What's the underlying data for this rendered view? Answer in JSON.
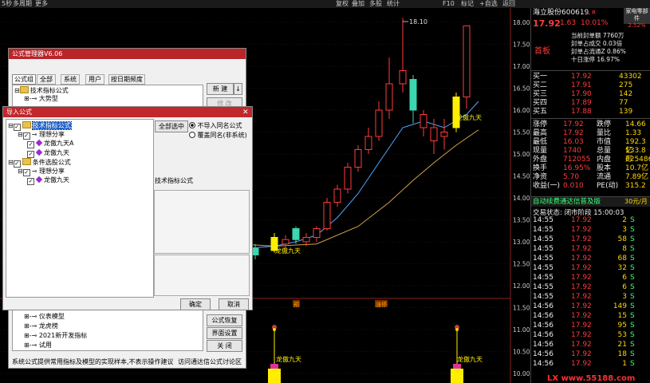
{
  "toolbar": {
    "left": [
      "5秒",
      "多周期",
      "更多"
    ],
    "right": [
      "复权",
      "叠加",
      "多股",
      "统计",
      "F10",
      "标记",
      "+自选",
      "返回"
    ]
  },
  "chart": {
    "peak_label": "18.10",
    "signal_label": "龙傲九天",
    "marker_yu": "预",
    "marker_zhang": "涨停",
    "price_ticks": [
      "18.00",
      "17.50",
      "17.00",
      "16.50",
      "16.00",
      "15.50",
      "15.00",
      "14.50",
      "14.00",
      "13.50",
      "13.00",
      "12.50",
      "12.00",
      "11.50",
      "11.00",
      "10.50",
      "10.00"
    ],
    "colors": {
      "up": "#ff3b3b",
      "down": "#3bd6b0",
      "signal": "#ffee00",
      "ma1": "#4fa8ff",
      "ma2": "#d4a24a"
    }
  },
  "quote": {
    "name": "海立股份",
    "code": "600619",
    "flag": "L R",
    "industry": "家电零部件",
    "industry_pct": "2.52%",
    "price": "17.92",
    "change": "1.63",
    "pct": "10.01%",
    "board": "首板",
    "seal_vol": "当前封单额 7760万",
    "seal_ratio_float": "封单占成交 0.03倍",
    "seal_ratio_z": "封单占流通Z 0.86%",
    "ten_day": "十日涨停 16.97%",
    "orders": [
      {
        "label": "买一",
        "price": "17.92",
        "vol": "43302"
      },
      {
        "label": "买二",
        "price": "17.91",
        "vol": "275"
      },
      {
        "label": "买三",
        "price": "17.90",
        "vol": "142"
      },
      {
        "label": "买四",
        "price": "17.89",
        "vol": "77"
      },
      {
        "label": "买五",
        "price": "17.88",
        "vol": "139"
      }
    ],
    "stats": [
      {
        "l1": "涨停",
        "v1": "17.92",
        "l2": "跌停",
        "v2": "14.66"
      },
      {
        "l1": "最高",
        "v1": "17.92",
        "l2": "量比",
        "v2": "1.33"
      },
      {
        "l1": "最低",
        "v1": "16.03",
        "l2": "市值",
        "v2": "192.3亿"
      },
      {
        "l1": "现量",
        "v1": "1740",
        "l2": "总量",
        "v2": "133.8万"
      },
      {
        "l1": "外盘",
        "v1": "712055",
        "l2": "内盘",
        "v2": "625486"
      },
      {
        "l1": "换手",
        "v1": "16.95%",
        "l2": "股本",
        "v2": "10.7亿"
      },
      {
        "l1": "净资",
        "v1": "5.70",
        "l2": "流通",
        "v2": "7.89亿"
      },
      {
        "l1": "收益(一)",
        "v1": "0.010",
        "l2": "PE(动)",
        "v2": "315.2"
      }
    ],
    "promo": "自动续费通达信普及版",
    "promo_price": "30元/月",
    "trade_status": "交易状态: 闭市阶段 15:00:03",
    "ticks": [
      {
        "t": "14:55",
        "p": "17.92",
        "v": "2",
        "s": "S"
      },
      {
        "t": "14:55",
        "p": "17.92",
        "v": "3",
        "s": "S"
      },
      {
        "t": "14:55",
        "p": "17.92",
        "v": "58",
        "s": "S"
      },
      {
        "t": "14:55",
        "p": "17.92",
        "v": "8",
        "s": "S"
      },
      {
        "t": "14:55",
        "p": "17.92",
        "v": "68",
        "s": "S"
      },
      {
        "t": "14:55",
        "p": "17.92",
        "v": "32",
        "s": "S"
      },
      {
        "t": "14:55",
        "p": "17.92",
        "v": "6",
        "s": "S"
      },
      {
        "t": "14:55",
        "p": "17.92",
        "v": "6",
        "s": "S"
      },
      {
        "t": "14:55",
        "p": "17.92",
        "v": "3",
        "s": "S"
      },
      {
        "t": "14:56",
        "p": "17.92",
        "v": "149",
        "s": "S"
      },
      {
        "t": "14:56",
        "p": "17.92",
        "v": "15",
        "s": "S"
      },
      {
        "t": "14:56",
        "p": "17.92",
        "v": "95",
        "s": "S"
      },
      {
        "t": "14:56",
        "p": "17.92",
        "v": "53",
        "s": "S"
      },
      {
        "t": "14:56",
        "p": "17.92",
        "v": "21",
        "s": "S"
      },
      {
        "t": "14:56",
        "p": "17.92",
        "v": "18",
        "s": "S"
      },
      {
        "t": "14:56",
        "p": "17.92",
        "v": "1",
        "s": "S"
      }
    ],
    "watermark": "LX www.55188.com"
  },
  "formula_mgr": {
    "title": "公式管理器V6.06",
    "tabs": [
      "公式组",
      "全部",
      "系统",
      "用户",
      "按日期频度"
    ],
    "tree_top": [
      "技术指标公式",
      "大势型"
    ],
    "tree_bottom": [
      "仪表模型",
      "龙虎榜",
      "2021新开发指标",
      "试用"
    ],
    "btn_new": "新 建",
    "btn_edit": "修 改",
    "btn_restore": "公式恢复",
    "btn_ui": "界面设置",
    "btn_close": "关 闭",
    "footer": "系统公式提供常用指标及模型的实现样本,不表示操作建议",
    "footer_link": "访问通达信公式讨论区"
  },
  "import_dlg": {
    "title": "导入公式",
    "tree": [
      {
        "label": "技术指标公式",
        "level": 0,
        "kind": "folder",
        "selected": true
      },
      {
        "label": "理想分享",
        "level": 1,
        "kind": "key"
      },
      {
        "label": "龙傲九天A",
        "level": 2,
        "kind": "item"
      },
      {
        "label": "龙傲九天",
        "level": 2,
        "kind": "item"
      },
      {
        "label": "条件选股公式",
        "level": 0,
        "kind": "folder"
      },
      {
        "label": "理想分享",
        "level": 1,
        "kind": "key"
      },
      {
        "label": "龙傲九天",
        "level": 2,
        "kind": "item"
      }
    ],
    "btn_select_all": "全部选中",
    "opt1": "不导入同名公式",
    "opt2": "覆盖同名(非系统)",
    "desc_label": "技术指标公式",
    "btn_ok": "确定",
    "btn_cancel": "取消"
  }
}
